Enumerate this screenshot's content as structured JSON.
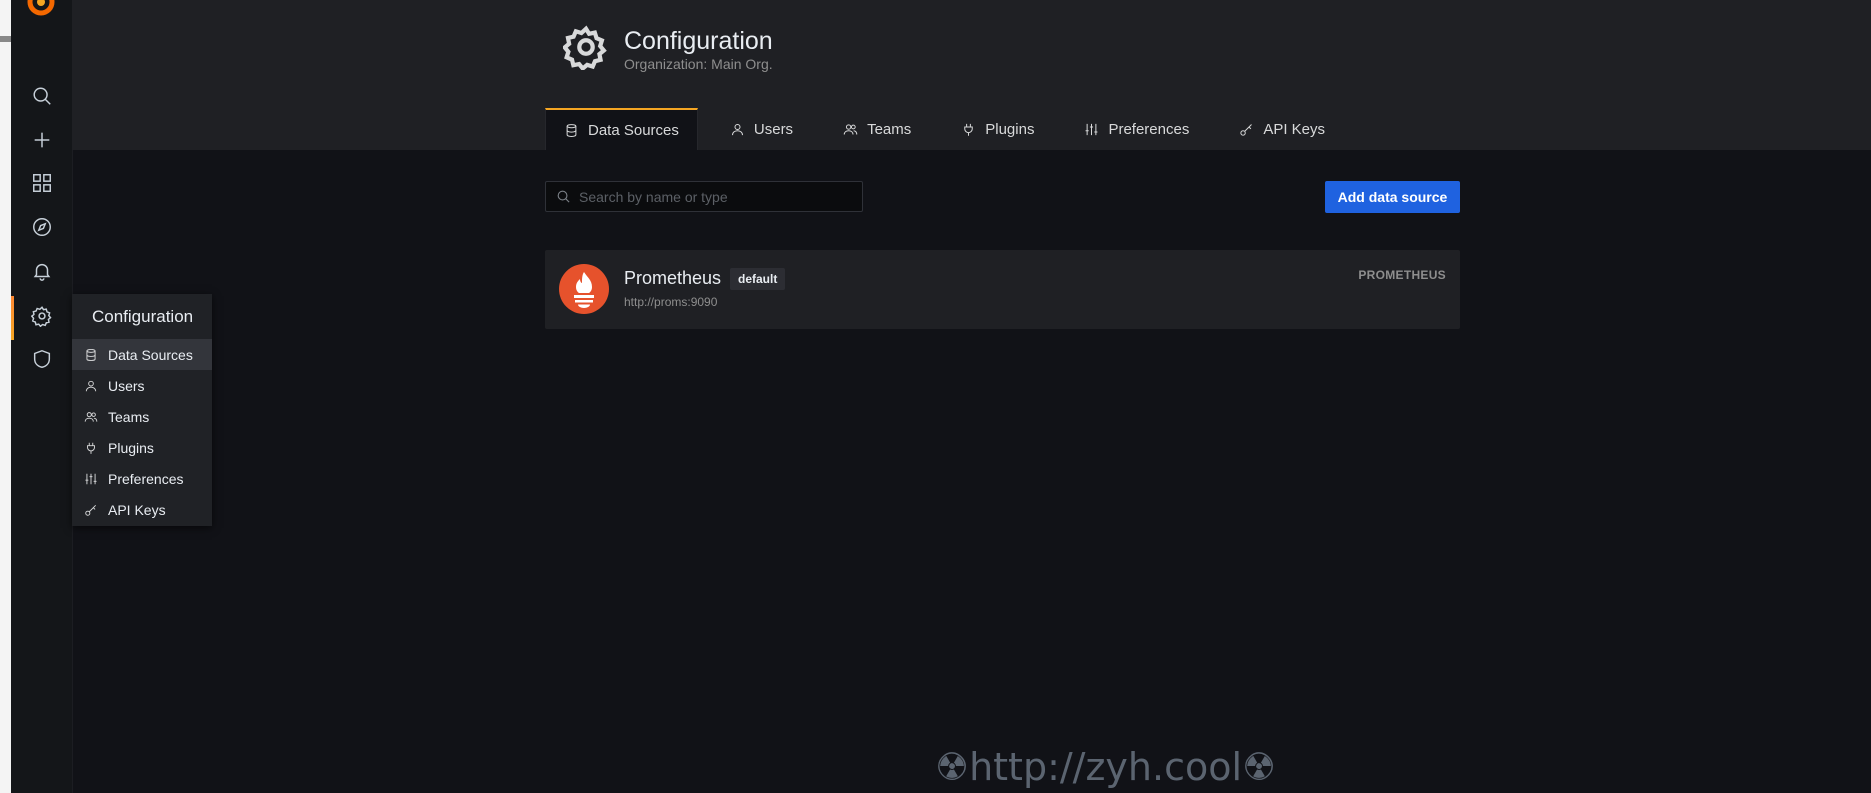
{
  "header": {
    "title": "Configuration",
    "subtitle": "Organization: Main Org."
  },
  "tabs": [
    {
      "label": "Data Sources",
      "icon": "database-icon",
      "active": true
    },
    {
      "label": "Users",
      "icon": "user-icon"
    },
    {
      "label": "Teams",
      "icon": "users-icon"
    },
    {
      "label": "Plugins",
      "icon": "plug-icon"
    },
    {
      "label": "Preferences",
      "icon": "sliders-icon"
    },
    {
      "label": "API Keys",
      "icon": "key-icon"
    }
  ],
  "search": {
    "placeholder": "Search by name or type",
    "value": ""
  },
  "add_button": {
    "label": "Add data source"
  },
  "datasource": {
    "name": "Prometheus",
    "badge": "default",
    "url": "http://proms:9090",
    "type": "PROMETHEUS",
    "logo": "prometheus-logo"
  },
  "sidebar": {
    "items": [
      {
        "icon": "search-icon"
      },
      {
        "icon": "plus-icon"
      },
      {
        "icon": "dashboards-icon"
      },
      {
        "icon": "compass-icon"
      },
      {
        "icon": "bell-icon"
      },
      {
        "icon": "gear-icon",
        "active": true
      },
      {
        "icon": "shield-icon"
      }
    ]
  },
  "config_menu": {
    "title": "Configuration",
    "items": [
      {
        "label": "Data Sources",
        "icon": "database-icon",
        "active": true
      },
      {
        "label": "Users",
        "icon": "user-icon"
      },
      {
        "label": "Teams",
        "icon": "users-icon"
      },
      {
        "label": "Plugins",
        "icon": "plug-icon"
      },
      {
        "label": "Preferences",
        "icon": "sliders-icon"
      },
      {
        "label": "API Keys",
        "icon": "key-icon"
      }
    ]
  },
  "watermark": "☢http://zyh.cool☢",
  "colors": {
    "accent": "#f5a623",
    "primary_button": "#1f62e0",
    "prometheus": "#e6522c"
  }
}
